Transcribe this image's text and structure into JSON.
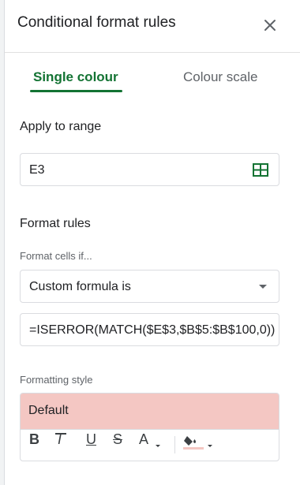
{
  "panel": {
    "title": "Conditional format rules"
  },
  "tabs": [
    {
      "label": "Single colour",
      "active": true
    },
    {
      "label": "Colour scale",
      "active": false
    }
  ],
  "apply_range": {
    "label": "Apply to range",
    "value": "E3",
    "icon": "grid-select-icon"
  },
  "format_rules": {
    "label": "Format rules",
    "condition_label": "Format cells if...",
    "condition_value": "Custom formula is",
    "formula_value": "=ISERROR(MATCH($E$3,$B$5:$B$100,0))"
  },
  "formatting_style": {
    "label": "Formatting style",
    "preset": "Default",
    "preview_bg": "#f4c7c3",
    "toolbar": {
      "bold": "B",
      "italic": "I",
      "underline": "U",
      "strikethrough": "S",
      "text_color": "A"
    }
  },
  "colors": {
    "accent": "#137333",
    "text": "#202124",
    "muted": "#5f6368",
    "border": "#dadce0",
    "fill_underline": "#f4c7c3"
  }
}
